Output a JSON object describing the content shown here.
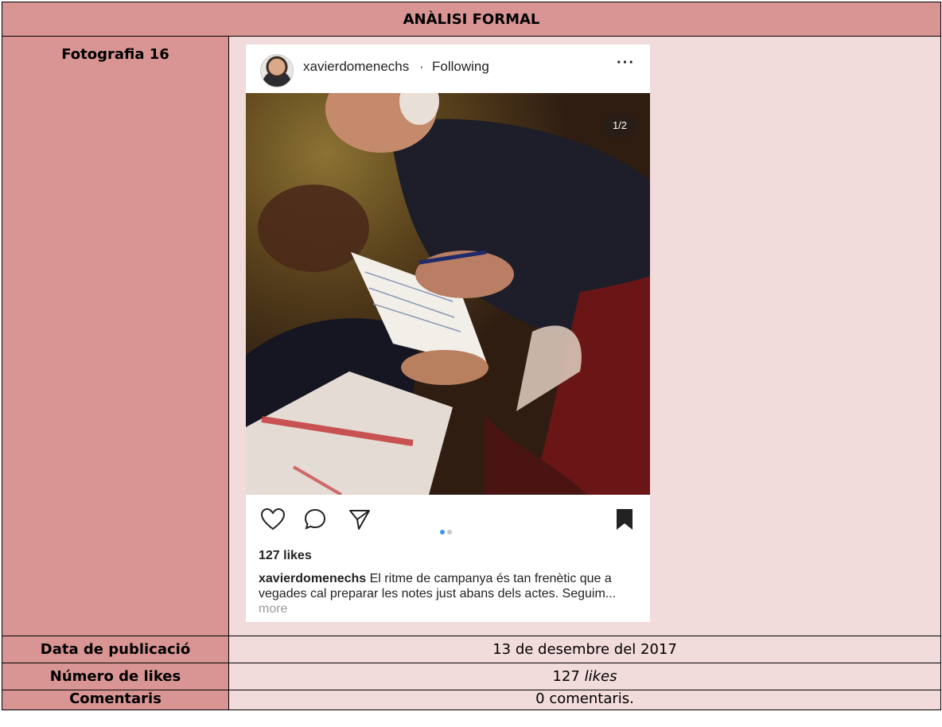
{
  "table": {
    "header": "ANÀLISI FORMAL",
    "photo_label": "Fotografia 16",
    "rows": [
      {
        "label": "Data de publicació",
        "value": "13 de desembre del 2017"
      },
      {
        "label": "Número de likes",
        "value_number": "127 ",
        "value_unit": "likes"
      },
      {
        "label": "Comentaris",
        "value": "0 comentaris."
      }
    ]
  },
  "post": {
    "username": "xavierdomenechs",
    "separator": "·",
    "follow_status": "Following",
    "more_menu": "···",
    "image_counter": "1/2",
    "likes": "127 likes",
    "caption_username": "xavierdomenechs",
    "caption_text": " El ritme de campanya és tan frenètic que a vegades cal preparar les notes just abans dels actes. Seguim...",
    "caption_more": " more",
    "carousel_active_color": "#3897f0",
    "carousel_inactive_color": "#c7c7c7",
    "icons": [
      "heart-icon",
      "comment-icon",
      "share-icon",
      "bookmark-icon"
    ]
  }
}
